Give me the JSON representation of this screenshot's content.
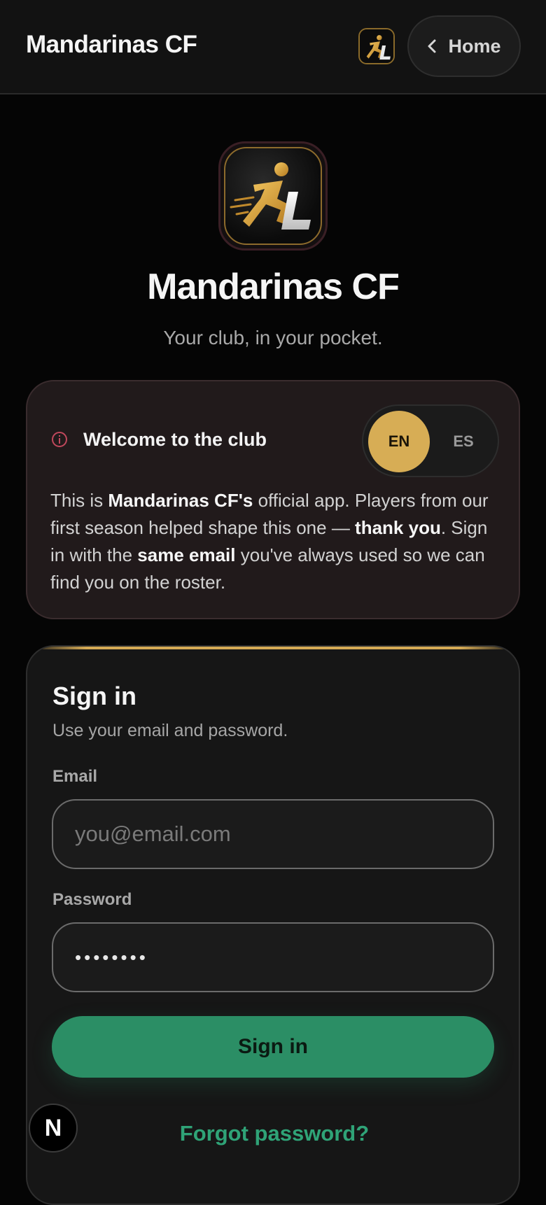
{
  "header": {
    "title": "Mandarinas CF",
    "home_label": "Home",
    "logo_icon": "club-logo-icon",
    "back_icon": "chevron-left-icon"
  },
  "hero": {
    "title": "Mandarinas CF",
    "tagline": "Your club, in your pocket."
  },
  "welcome": {
    "title": "Welcome to the club",
    "icon": "info-icon",
    "languages": [
      "EN",
      "ES"
    ],
    "selected_language": "EN",
    "body": {
      "p1": "This is ",
      "b1": "Mandarinas CF's",
      "p2": " official app. Players from our first season helped shape this one — ",
      "b2": "thank you",
      "p3": ". Sign in with the ",
      "b3": "same email",
      "p4": " you've always used so we can find you on the roster."
    }
  },
  "signin": {
    "title": "Sign in",
    "subtitle": "Use your email and password.",
    "email_label": "Email",
    "email_placeholder": "you@email.com",
    "email_value": "",
    "password_label": "Password",
    "password_value": "••••••••",
    "submit_label": "Sign in",
    "forgot_label": "Forgot password?"
  },
  "dev_badge": {
    "label": "N"
  },
  "colors": {
    "accent_gold": "#d7ad55",
    "primary_green": "#2b8e65",
    "link_green": "#2fa377",
    "info_red": "#c0485c",
    "background": "#050505"
  }
}
